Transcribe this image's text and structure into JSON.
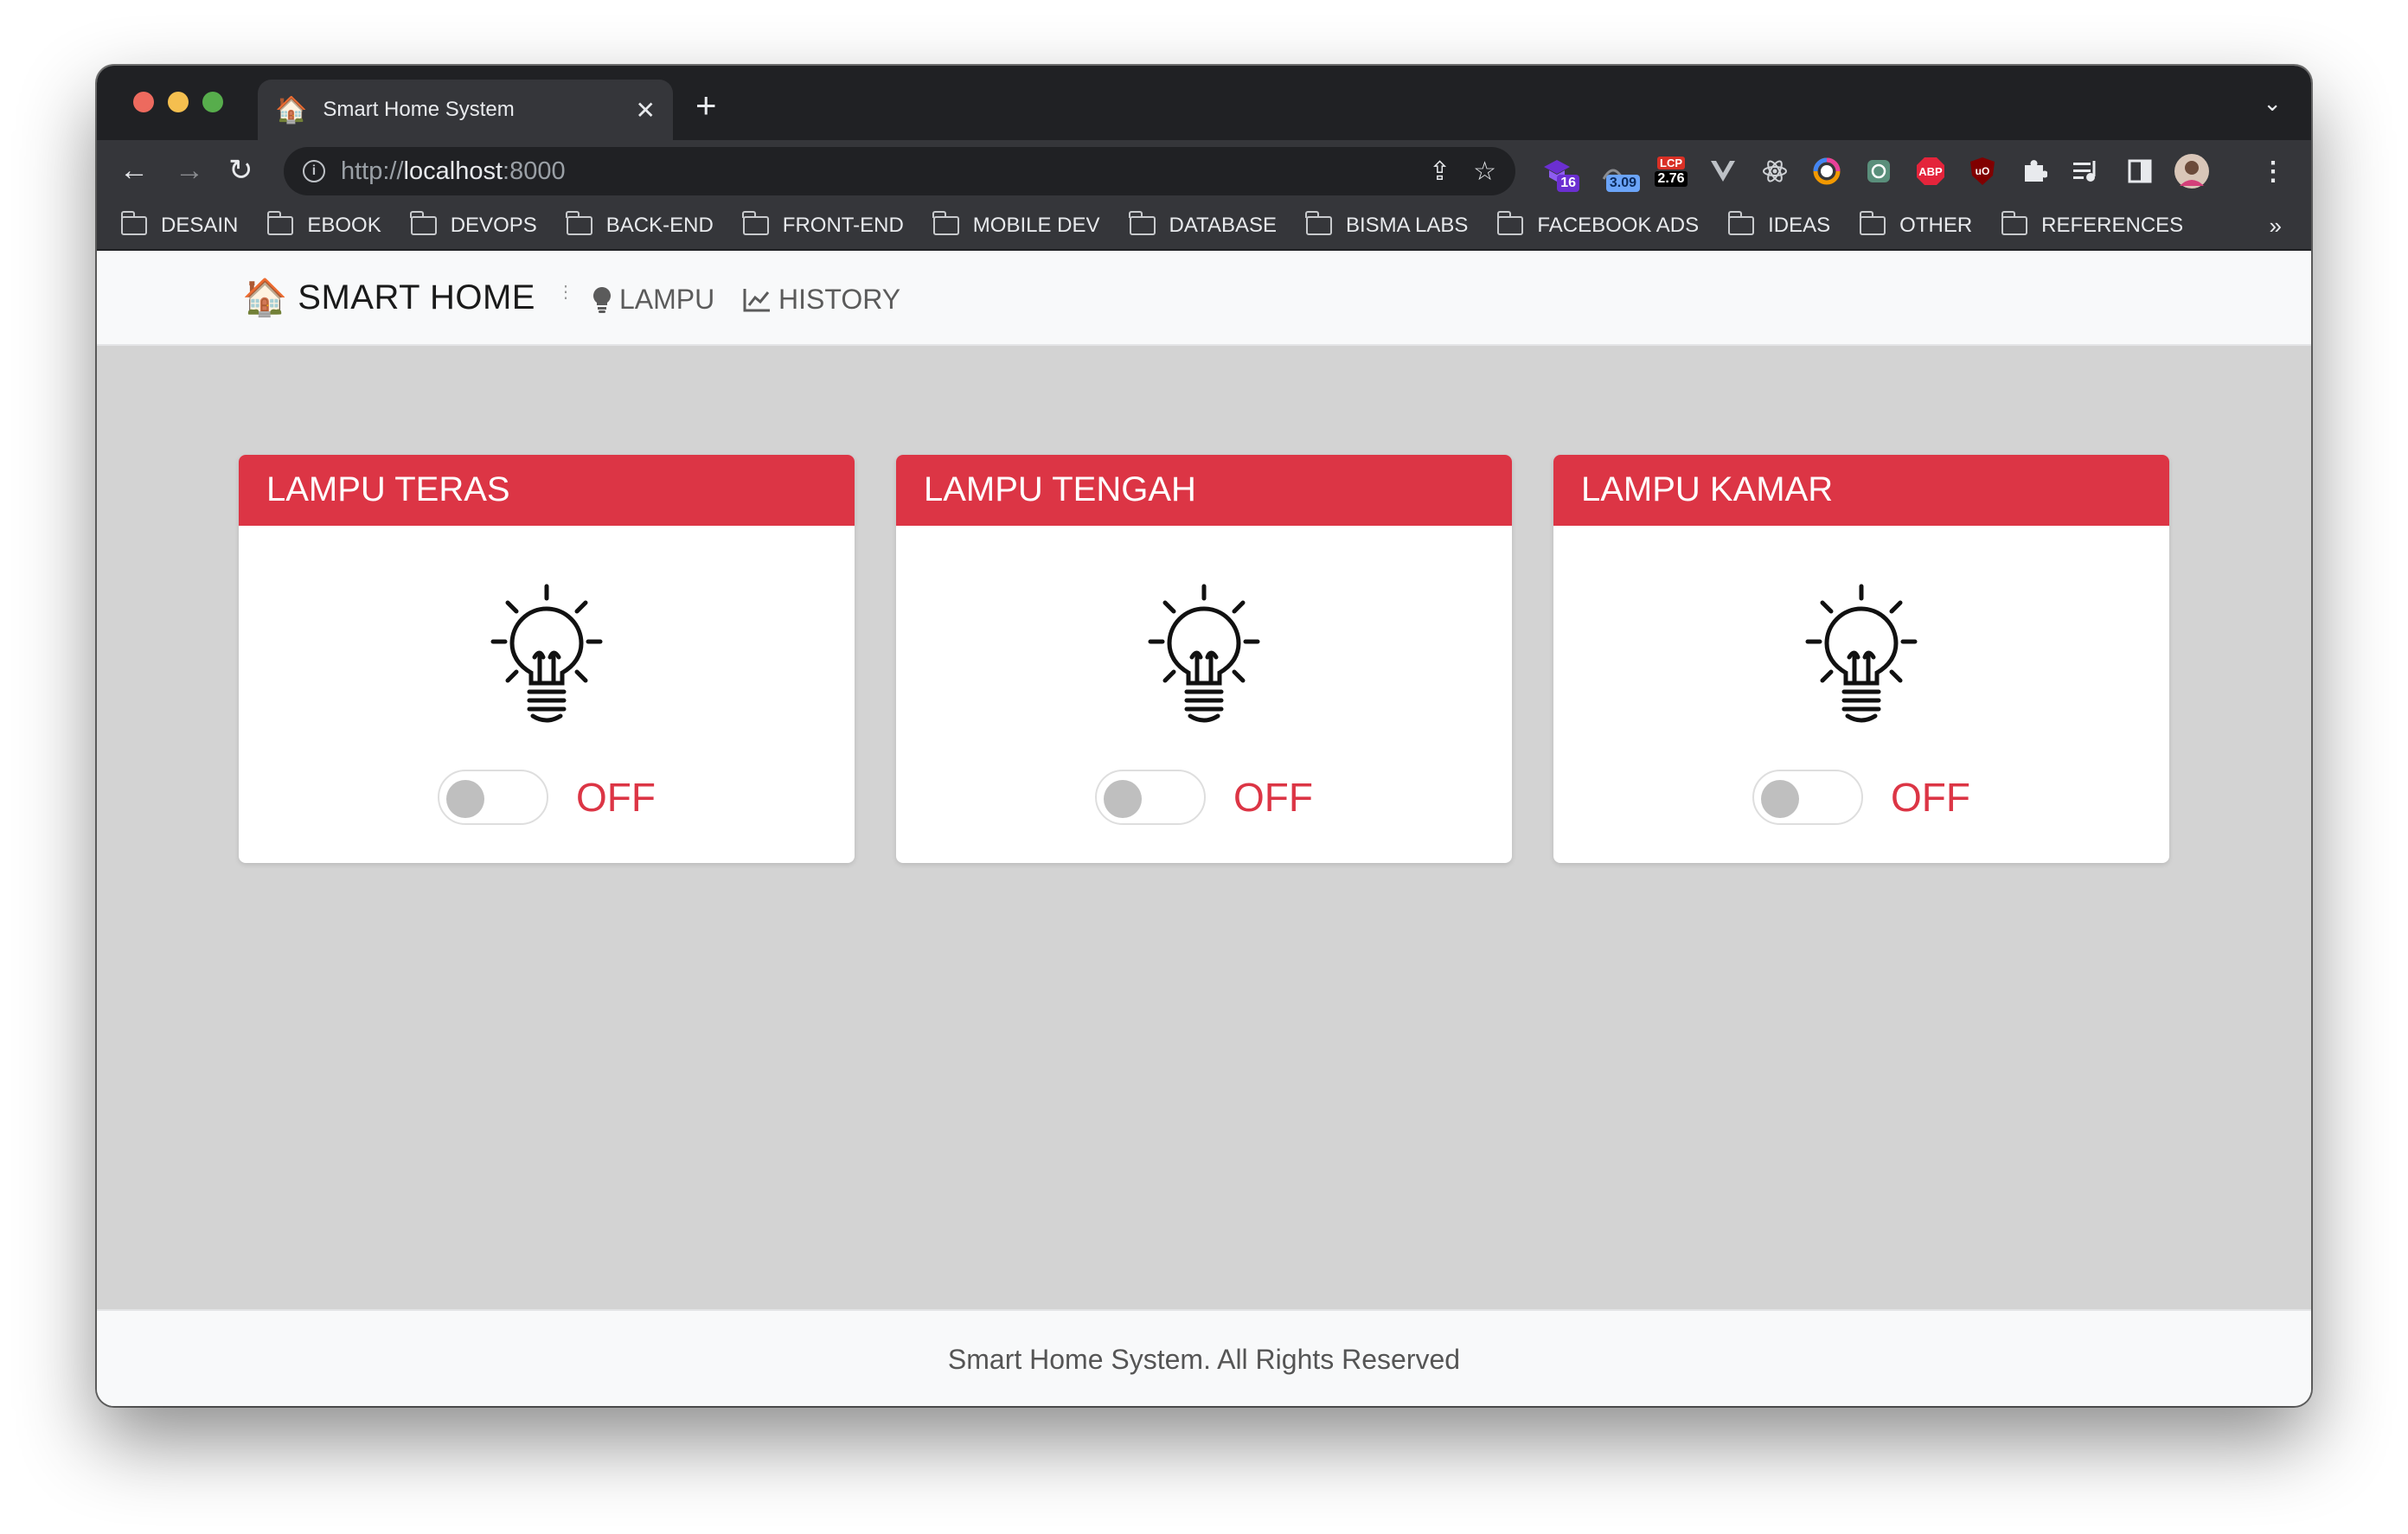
{
  "browser": {
    "tab": {
      "title": "Smart Home System",
      "favicon": "house-icon"
    },
    "new_tab": "+",
    "url": {
      "scheme": "http://",
      "host": "localhost",
      "port": ":8000"
    },
    "extensions": [
      {
        "name": "ext-16",
        "badge": "16",
        "color": "#7b3fe4"
      },
      {
        "name": "ext-3.09",
        "badge": "3.09",
        "color": "#6ba4f8"
      },
      {
        "name": "ext-lcp",
        "label": "LCP",
        "badge": "2.76",
        "color": "#d93025"
      },
      {
        "name": "vue-icon"
      },
      {
        "name": "react-icon"
      },
      {
        "name": "color-ring-icon"
      },
      {
        "name": "chatgpt-icon"
      },
      {
        "name": "abp-icon",
        "label": "ABP"
      },
      {
        "name": "ublock-icon",
        "label": "uO"
      },
      {
        "name": "puzzle-icon"
      },
      {
        "name": "media-icon"
      },
      {
        "name": "sidepanel-icon"
      },
      {
        "name": "profile-avatar"
      }
    ],
    "bookmarks": [
      "DESAIN",
      "EBOOK",
      "DEVOPS",
      "BACK-END",
      "FRONT-END",
      "MOBILE DEV",
      "DATABASE",
      "BISMA LABS",
      "FACEBOOK ADS",
      "IDEAS",
      "OTHER",
      "REFERENCES"
    ],
    "bookmarks_more": "»"
  },
  "navbar": {
    "brand": "SMART HOME",
    "links": [
      {
        "label": "LAMPU",
        "icon": "lightbulb-icon"
      },
      {
        "label": "HISTORY",
        "icon": "chart-line-icon"
      }
    ]
  },
  "cards": [
    {
      "title": "LAMPU TERAS",
      "state": "OFF"
    },
    {
      "title": "LAMPU TENGAH",
      "state": "OFF"
    },
    {
      "title": "LAMPU KAMAR",
      "state": "OFF"
    }
  ],
  "colors": {
    "header_red": "#dc3545",
    "page_bg": "#d3d3d3"
  },
  "footer": "Smart Home System. All Rights Reserved"
}
